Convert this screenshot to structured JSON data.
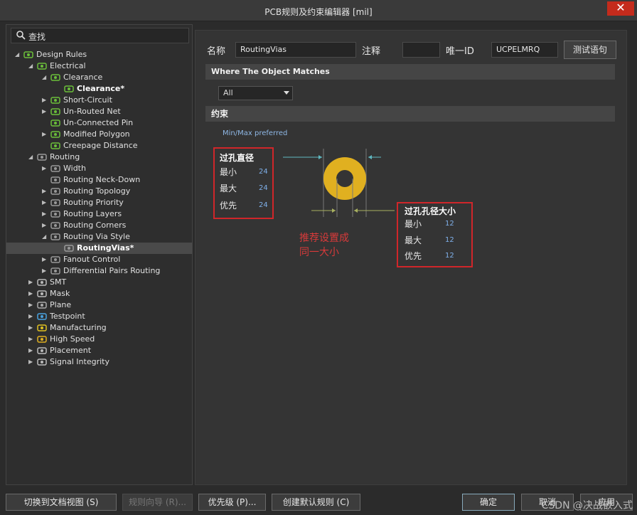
{
  "window": {
    "title": "PCB规则及约束编辑器 [mil]",
    "close_glyph": "✕"
  },
  "search": {
    "placeholder": "查找"
  },
  "tree": [
    {
      "label": "Design Rules",
      "level": 0,
      "arrow": "◢",
      "icon": "design-rules-icon",
      "bold": false
    },
    {
      "label": "Electrical",
      "level": 1,
      "arrow": "◢",
      "icon": "electrical-icon",
      "bold": false
    },
    {
      "label": "Clearance",
      "level": 2,
      "arrow": "◢",
      "icon": "clearance-icon",
      "bold": false
    },
    {
      "label": "Clearance*",
      "level": 3,
      "arrow": "",
      "icon": "clearance-rule-icon",
      "bold": true
    },
    {
      "label": "Short-Circuit",
      "level": 2,
      "arrow": "▶",
      "icon": "short-circuit-icon",
      "bold": false
    },
    {
      "label": "Un-Routed Net",
      "level": 2,
      "arrow": "▶",
      "icon": "unrouted-net-icon",
      "bold": false
    },
    {
      "label": "Un-Connected Pin",
      "level": 2,
      "arrow": "",
      "icon": "unconnected-pin-icon",
      "bold": false
    },
    {
      "label": "Modified Polygon",
      "level": 2,
      "arrow": "▶",
      "icon": "modified-polygon-icon",
      "bold": false
    },
    {
      "label": "Creepage Distance",
      "level": 2,
      "arrow": "",
      "icon": "creepage-icon",
      "bold": false
    },
    {
      "label": "Routing",
      "level": 1,
      "arrow": "◢",
      "icon": "routing-icon",
      "bold": false
    },
    {
      "label": "Width",
      "level": 2,
      "arrow": "▶",
      "icon": "width-icon",
      "bold": false
    },
    {
      "label": "Routing Neck-Down",
      "level": 2,
      "arrow": "",
      "icon": "neck-down-icon",
      "bold": false
    },
    {
      "label": "Routing Topology",
      "level": 2,
      "arrow": "▶",
      "icon": "topology-icon",
      "bold": false
    },
    {
      "label": "Routing Priority",
      "level": 2,
      "arrow": "▶",
      "icon": "priority-icon",
      "bold": false
    },
    {
      "label": "Routing Layers",
      "level": 2,
      "arrow": "▶",
      "icon": "layers-icon",
      "bold": false
    },
    {
      "label": "Routing Corners",
      "level": 2,
      "arrow": "▶",
      "icon": "corners-icon",
      "bold": false
    },
    {
      "label": "Routing Via Style",
      "level": 2,
      "arrow": "◢",
      "icon": "via-style-icon",
      "bold": false
    },
    {
      "label": "RoutingVias*",
      "level": 3,
      "arrow": "",
      "icon": "routing-vias-icon",
      "bold": true,
      "selected": true
    },
    {
      "label": "Fanout Control",
      "level": 2,
      "arrow": "▶",
      "icon": "fanout-icon",
      "bold": false
    },
    {
      "label": "Differential Pairs Routing",
      "level": 2,
      "arrow": "▶",
      "icon": "diff-pairs-icon",
      "bold": false
    },
    {
      "label": "SMT",
      "level": 1,
      "arrow": "▶",
      "icon": "smt-icon",
      "bold": false
    },
    {
      "label": "Mask",
      "level": 1,
      "arrow": "▶",
      "icon": "mask-icon",
      "bold": false
    },
    {
      "label": "Plane",
      "level": 1,
      "arrow": "▶",
      "icon": "plane-icon",
      "bold": false
    },
    {
      "label": "Testpoint",
      "level": 1,
      "arrow": "▶",
      "icon": "testpoint-icon",
      "bold": false
    },
    {
      "label": "Manufacturing",
      "level": 1,
      "arrow": "▶",
      "icon": "manufacturing-icon",
      "bold": false
    },
    {
      "label": "High Speed",
      "level": 1,
      "arrow": "▶",
      "icon": "high-speed-icon",
      "bold": false
    },
    {
      "label": "Placement",
      "level": 1,
      "arrow": "▶",
      "icon": "placement-icon",
      "bold": false
    },
    {
      "label": "Signal Integrity",
      "level": 1,
      "arrow": "▶",
      "icon": "signal-integrity-icon",
      "bold": false
    }
  ],
  "rule": {
    "name_label": "名称",
    "name_value": "RoutingVias",
    "comment_label": "注释",
    "comment_value": "",
    "id_label": "唯一ID",
    "id_value": "UCPELMRQ",
    "test_button": "测试语句"
  },
  "where": {
    "header": "Where The Object Matches",
    "selected": "All"
  },
  "constraints": {
    "header": "约束",
    "hint": "Min/Max preferred",
    "via_diameter": {
      "title": "过孔直径",
      "min_label": "最小",
      "min": "24",
      "max_label": "最大",
      "max": "24",
      "pref_label": "优先",
      "pref": "24"
    },
    "hole_size": {
      "title": "过孔孔径大小",
      "min_label": "最小",
      "min": "12",
      "max_label": "最大",
      "max": "12",
      "pref_label": "优先",
      "pref": "12"
    },
    "note_line1": "推荐设置成",
    "note_line2": "同一大小",
    "via_color": "#e0b020",
    "accent_red": "#d0262a"
  },
  "bottom": {
    "switch_doc": "切换到文档视图 (S)",
    "wizard": "规则向导 (R)...",
    "priority": "优先级 (P)...",
    "create_default": "创建默认规则 (C)",
    "ok": "确定",
    "cancel": "取消",
    "apply": "应用"
  },
  "watermark": "CSDN @决战嵌入式"
}
